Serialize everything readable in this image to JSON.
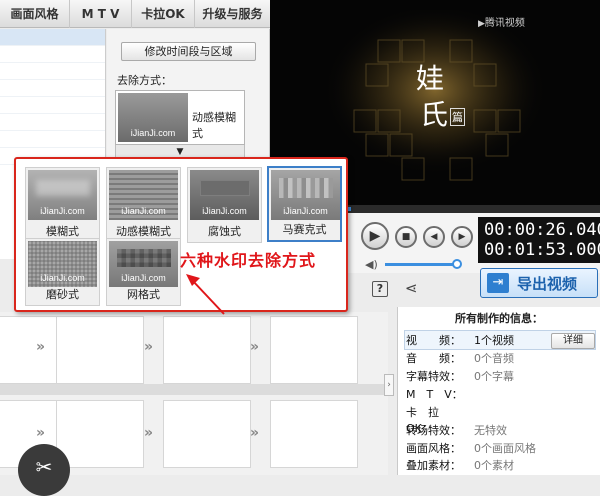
{
  "menu": {
    "items": [
      "画面风格",
      "M T V",
      "卡拉OK",
      "升级与服务"
    ]
  },
  "settings": {
    "modify_button": "修改时间段与区域",
    "removal_label": "去除方式：",
    "current_method": "动感模糊式",
    "thumb_watermark": "iJianJi.com",
    "dropdown_arrow": "▼"
  },
  "video": {
    "logo_text": "腾讯视频",
    "title_chars": [
      "娃",
      "氏"
    ],
    "title_tag": "篇"
  },
  "player": {
    "current_time": "00:00:26.040",
    "total_time": "00:01:53.000"
  },
  "toolbar": {
    "export_label": "导出视频"
  },
  "popup": {
    "watermark": "iJianJi.com",
    "options": [
      "模糊式",
      "动感模糊式",
      "腐蚀式",
      "马赛克式",
      "磨砂式",
      "网格式"
    ],
    "selected_index": 3
  },
  "annotation": {
    "text": "六种水印去除方式"
  },
  "info": {
    "title": "所有制作的信息：",
    "detail_button": "详细",
    "rows": [
      {
        "key": "视　　频：",
        "value": "1个视频"
      },
      {
        "key": "音　　频：",
        "value": "0个音频"
      },
      {
        "key": "字幕特效：",
        "value": "0个字幕"
      },
      {
        "key": "M　T　V：",
        "value": ""
      },
      {
        "key": "卡　拉　OK：",
        "value": ""
      },
      {
        "key": "转场特效：",
        "value": "无特效"
      },
      {
        "key": "画面风格：",
        "value": "0个画面风格"
      },
      {
        "key": "叠加素材：",
        "value": "0个素材"
      }
    ]
  },
  "colors": {
    "accent_blue": "#2e7fd0",
    "annotation_red": "#e0161a",
    "popup_border": "#d9261c"
  }
}
